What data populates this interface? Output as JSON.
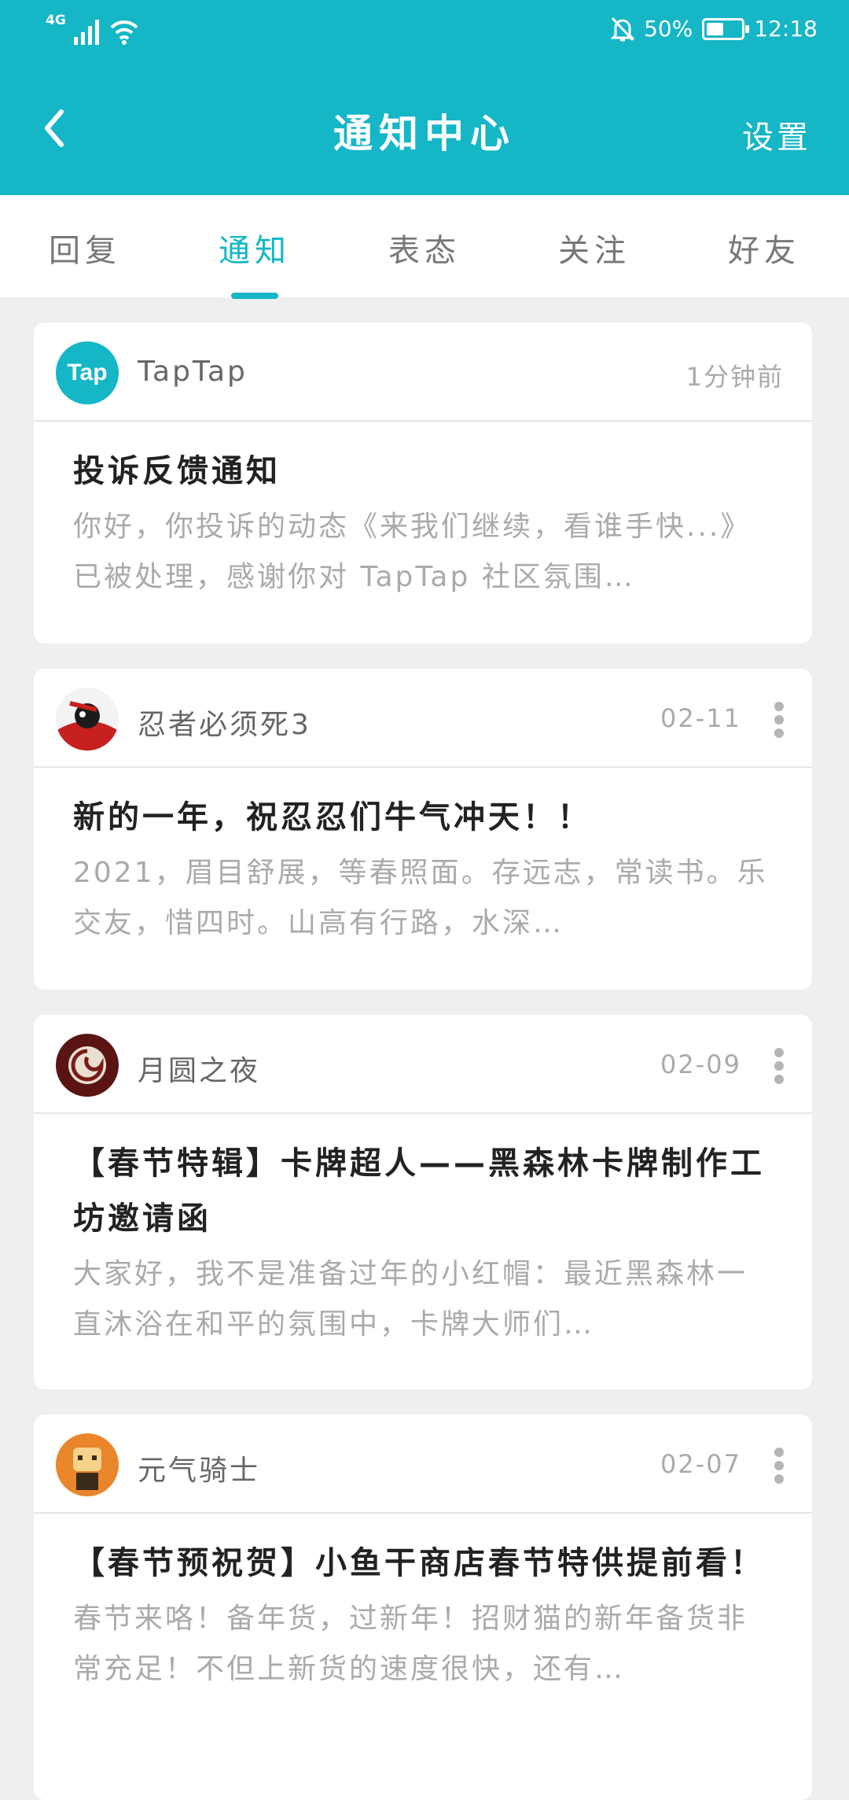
{
  "status_bar": {
    "network": "4G",
    "battery_text": "50%",
    "battery_level": 0.5,
    "time": "12:18"
  },
  "header": {
    "title": "通知中心",
    "settings_label": "设置"
  },
  "tabs": [
    {
      "label": "回复"
    },
    {
      "label": "通知"
    },
    {
      "label": "表态"
    },
    {
      "label": "关注"
    },
    {
      "label": "好友"
    }
  ],
  "active_tab": "通知",
  "accent_color": "#15b6c6",
  "notifications": [
    {
      "sender": "TapTap",
      "avatar_text": "Tap",
      "time": "1分钟前",
      "title": "投诉反馈通知",
      "text": "你好，你投诉的动态《来我们继续，看谁手快...》已被处理，感谢你对 TapTap 社区氛围…"
    },
    {
      "sender": "忍者必须死3",
      "time": "02-11",
      "title": "新的一年，祝忍忍们牛气冲天！！",
      "text": "2021，眉目舒展，等春照面。存远志，常读书。乐交友，惜四时。山高有行路，水深…"
    },
    {
      "sender": "月圆之夜",
      "time": "02-09",
      "title": "【春节特辑】卡牌超人——黑森林卡牌制作工坊邀请函",
      "text": "大家好，我不是准备过年的小红帽：最近黑森林一直沐浴在和平的氛围中，卡牌大师们…"
    },
    {
      "sender": "元气骑士",
      "time": "02-07",
      "title": "【春节预祝贺】小鱼干商店春节特供提前看！",
      "text": "春节来咯！备年货，过新年！招财猫的新年备货非常充足！不但上新货的速度很快，还有…"
    }
  ]
}
